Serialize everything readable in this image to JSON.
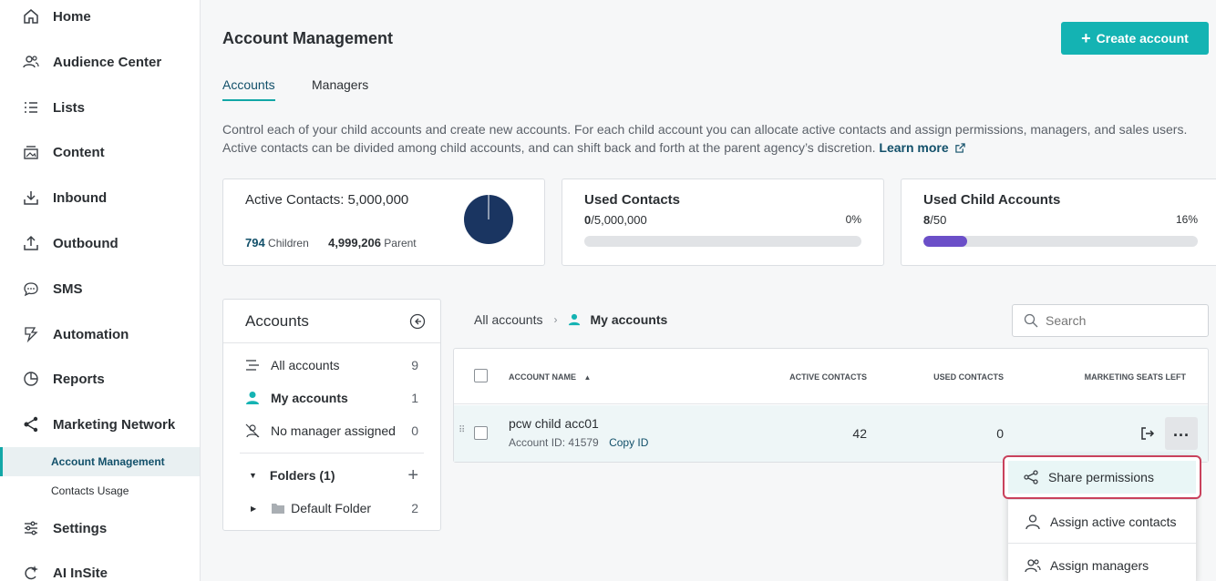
{
  "sidebar": {
    "items": [
      {
        "label": "Home",
        "icon": "home-icon"
      },
      {
        "label": "Audience Center",
        "icon": "people-icon"
      },
      {
        "label": "Lists",
        "icon": "list-icon"
      },
      {
        "label": "Content",
        "icon": "content-icon"
      },
      {
        "label": "Inbound",
        "icon": "inbound-icon"
      },
      {
        "label": "Outbound",
        "icon": "outbound-icon"
      },
      {
        "label": "SMS",
        "icon": "sms-icon"
      },
      {
        "label": "Automation",
        "icon": "automation-icon"
      },
      {
        "label": "Reports",
        "icon": "reports-icon"
      },
      {
        "label": "Marketing Network",
        "icon": "network-icon"
      },
      {
        "label": "Settings",
        "icon": "settings-icon"
      },
      {
        "label": "AI InSite",
        "icon": "ai-icon"
      }
    ],
    "subitems": [
      {
        "label": "Account Management",
        "active": true
      },
      {
        "label": "Contacts Usage",
        "active": false
      }
    ]
  },
  "header": {
    "title": "Account Management",
    "create_label": "Create account"
  },
  "tabs": [
    {
      "label": "Accounts",
      "active": true
    },
    {
      "label": "Managers",
      "active": false
    }
  ],
  "description": {
    "text": "Control each of your child accounts and create new accounts. For each child account you can allocate active contacts and assign permissions, managers, and sales users. Active contacts can be divided among child accounts, and can shift back and forth at the parent agency’s discretion.",
    "link": "Learn more"
  },
  "cards": {
    "active": {
      "title": "Active Contacts: 5,000,000",
      "children_value": "794",
      "children_label": "Children",
      "parent_value": "4,999,206",
      "parent_label": "Parent",
      "children_fraction": 0.0002
    },
    "used_contacts": {
      "title": "Used Contacts",
      "used": "0",
      "total": "/5,000,000",
      "percent_label": "0%",
      "fraction": 0
    },
    "used_child": {
      "title": "Used Child Accounts",
      "used": "8",
      "total": "/50",
      "percent_label": "16%",
      "fraction": 0.16
    }
  },
  "accounts_panel": {
    "title": "Accounts",
    "rows": [
      {
        "label": "All accounts",
        "count": "9"
      },
      {
        "label": "My accounts",
        "count": "1"
      },
      {
        "label": "No manager assigned",
        "count": "0"
      }
    ],
    "folders_label": "Folders (1)",
    "folder": {
      "label": "Default Folder",
      "count": "2"
    }
  },
  "breadcrumb": {
    "root": "All accounts",
    "current": "My accounts"
  },
  "search": {
    "placeholder": "Search"
  },
  "table": {
    "columns": [
      "Account name",
      "Active contacts",
      "Used contacts",
      "Marketing seats left"
    ],
    "rows": [
      {
        "name": "pcw child acc01",
        "account_id": "Account ID: 41579",
        "copy_label": "Copy ID",
        "active_contacts": "42",
        "used_contacts": "0"
      }
    ]
  },
  "menu": {
    "items": [
      "Share permissions",
      "Assign active contacts",
      "Assign managers"
    ]
  },
  "colors": {
    "accent": "#14b3b3",
    "navy": "#1a3561",
    "progress": "#6b4fc8",
    "highlight_border": "#c9415c"
  }
}
